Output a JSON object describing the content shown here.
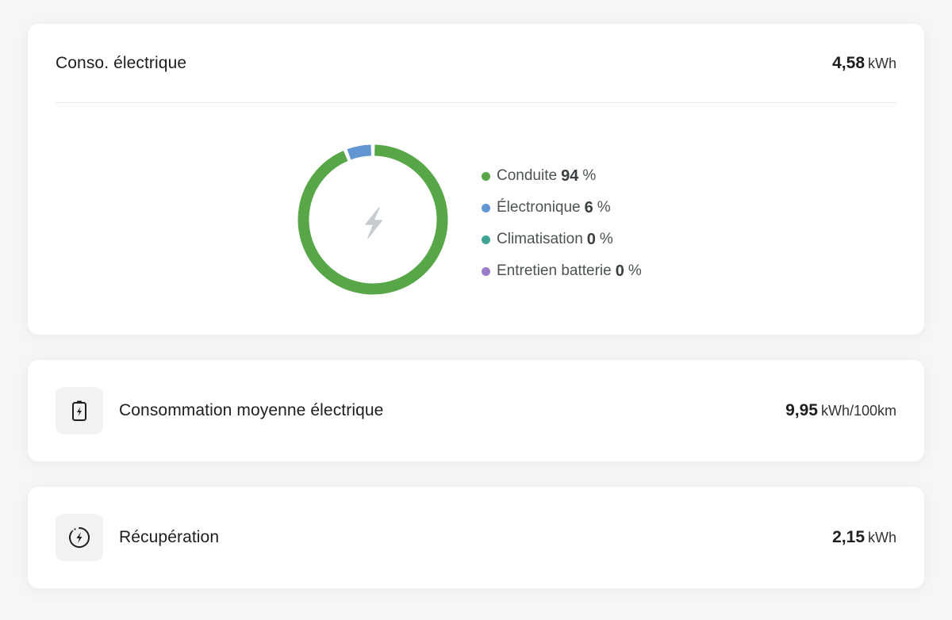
{
  "energy_card": {
    "title": "Conso. électrique",
    "value": "4,58",
    "unit": "kWh",
    "legend": [
      {
        "label": "Conduite",
        "value": "94",
        "unit": "%",
        "color": "#57a749"
      },
      {
        "label": "Électronique",
        "value": "6",
        "unit": "%",
        "color": "#6196d3"
      },
      {
        "label": "Climatisation",
        "value": "0",
        "unit": "%",
        "color": "#3fa493"
      },
      {
        "label": "Entretien batterie",
        "value": "0",
        "unit": "%",
        "color": "#9b7cc8"
      }
    ],
    "center_icon": "lightning-icon"
  },
  "chart_data": {
    "type": "pie",
    "categories": [
      "Conduite",
      "Électronique",
      "Climatisation",
      "Entretien batterie"
    ],
    "values": [
      94,
      6,
      0,
      0
    ],
    "colors": [
      "#57a749",
      "#6196d3",
      "#3fa493",
      "#9b7cc8"
    ],
    "legend": "right"
  },
  "avg_card": {
    "title": "Consommation moyenne électrique",
    "value": "9,95",
    "unit": "kWh/100km",
    "icon": "battery-charging-icon"
  },
  "recup_card": {
    "title": "Récupération",
    "value": "2,15",
    "unit": "kWh",
    "icon": "regeneration-icon"
  },
  "colors": {
    "background": "#f6f6f6",
    "card": "#ffffff",
    "divider": "#e3e8ea",
    "icon_box": "#f1f2f2"
  }
}
